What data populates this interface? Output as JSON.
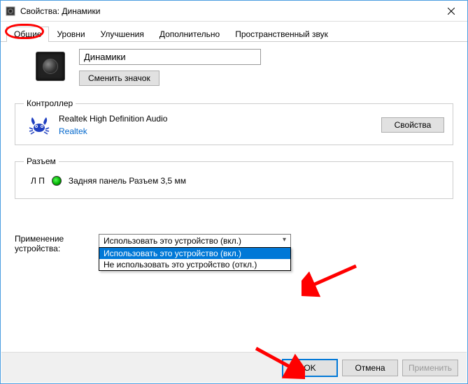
{
  "window": {
    "title": "Свойства: Динамики"
  },
  "tabs": {
    "general": "Общие",
    "levels": "Уровни",
    "enhancements": "Улучшения",
    "advanced": "Дополнительно",
    "spatial": "Пространственный звук"
  },
  "device": {
    "name": "Динамики",
    "change_icon_btn": "Сменить значок"
  },
  "controller": {
    "legend": "Контроллер",
    "name": "Realtek High Definition Audio",
    "vendor": "Realtek",
    "properties_btn": "Свойства"
  },
  "jack": {
    "legend": "Разъем",
    "channel": "Л П",
    "description": "Задняя панель Разъем 3,5 мм"
  },
  "usage": {
    "label": "Применение устройства:",
    "selected": "Использовать это устройство (вкл.)",
    "options": {
      "enable": "Использовать это устройство (вкл.)",
      "disable": "Не использовать это устройство (откл.)"
    }
  },
  "buttons": {
    "ok": "OK",
    "cancel": "Отмена",
    "apply": "Применить"
  }
}
